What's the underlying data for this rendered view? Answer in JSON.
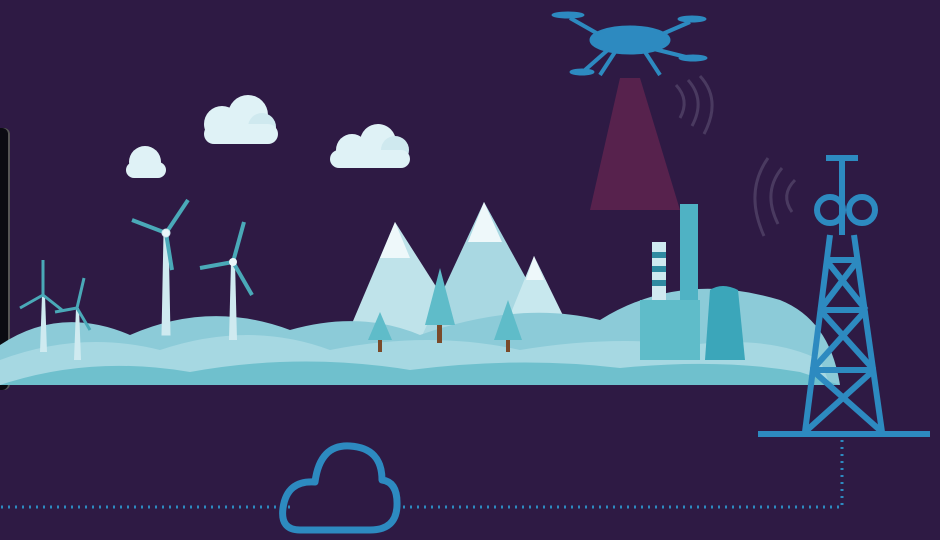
{
  "scene": {
    "background": "#2e1a44",
    "colors": {
      "landscape_light": "#cfeaf0",
      "landscape_mid": "#9ed3df",
      "landscape_teal": "#5fbcc9",
      "outline_blue": "#2d8ac0",
      "drone_blue": "#2d8ac0",
      "drone_beam": "#7a2a55"
    },
    "icons": [
      "cloud-icon",
      "wind-turbine-icon",
      "mountain-icon",
      "pine-tree-icon",
      "factory-icon",
      "drone-icon",
      "signal-waves-icon",
      "radio-tower-icon",
      "cloud-outline-icon",
      "dotted-connection-line"
    ]
  }
}
